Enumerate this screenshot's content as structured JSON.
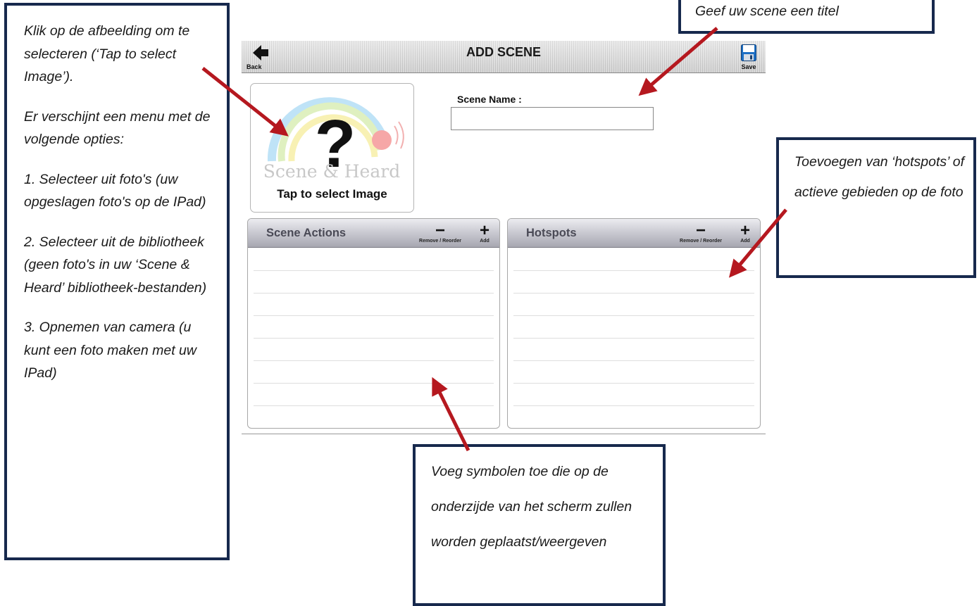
{
  "app": {
    "title": "ADD SCENE",
    "back_label": "Back",
    "save_label": "Save",
    "image_picker": {
      "prompt": "Tap to select Image",
      "placeholder_logo_text": "Scene & Heard"
    },
    "scene_name": {
      "label": "Scene Name :",
      "value": "",
      "placeholder": ""
    },
    "panels": {
      "scene_actions": {
        "title": "Scene Actions",
        "remove_label": "Remove / Reorder",
        "add_label": "Add",
        "rows": 7
      },
      "hotspots": {
        "title": "Hotspots",
        "remove_label": "Remove / Reorder",
        "add_label": "Add",
        "rows": 7
      }
    }
  },
  "annotations": {
    "left": [
      "Klik op de afbeelding om te selecteren (‘Tap to select Image’).",
      "Er verschijnt een menu met de volgende opties:",
      "1. Selecteer uit foto's (uw opgeslagen foto's op de IPad)",
      "2. Selecteer uit de bibliotheek (geen foto's in uw ‘Scene & Heard’ bibliotheek-bestanden)",
      "3. Opnemen van camera (u kunt een foto maken met uw IPad)"
    ],
    "title": "Geef uw scene een titel",
    "hotspots": "Toevoegen van ‘hotspots’ of actieve gebieden op de foto",
    "actions": "Voeg symbolen toe die op de onderzijde van het scherm zullen worden geplaatst/weergeven"
  },
  "colors": {
    "callout_border": "#17294d",
    "arrow": "#b5181f",
    "header_gradient_top": "#ececf0",
    "header_gradient_bottom": "#a7a7b1"
  }
}
